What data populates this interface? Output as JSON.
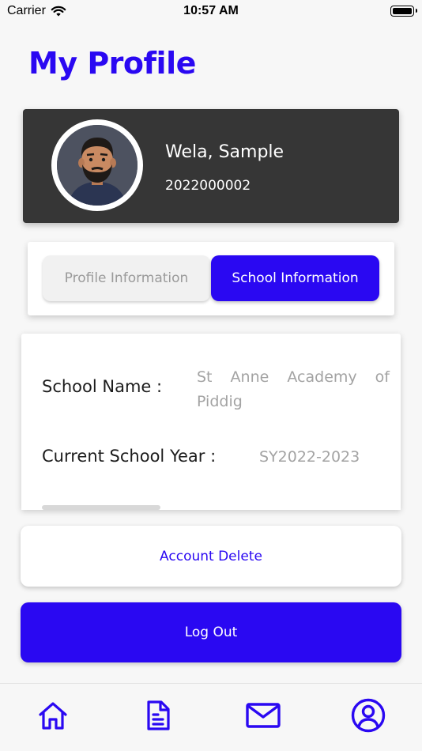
{
  "status_bar": {
    "carrier": "Carrier",
    "time": "10:57 AM"
  },
  "page": {
    "title": "My Profile"
  },
  "profile": {
    "name": "Wela, Sample",
    "student_id": "2022000002"
  },
  "tabs": [
    {
      "label": "Profile Information",
      "active": false
    },
    {
      "label": "School Information",
      "active": true
    }
  ],
  "school_info": {
    "school_name_label": "School Name :",
    "school_name_value": "St Anne Academy of Piddig",
    "school_year_label": "Current School Year :",
    "school_year_value": "SY2022-2023"
  },
  "actions": {
    "delete_label": "Account Delete",
    "logout_label": "Log Out"
  },
  "bottom_nav": [
    "home-icon",
    "document-icon",
    "mail-icon",
    "user-circle-icon"
  ],
  "colors": {
    "accent": "#2a08f2",
    "card_dark": "#363636",
    "muted_text": "#a3a3a3"
  }
}
